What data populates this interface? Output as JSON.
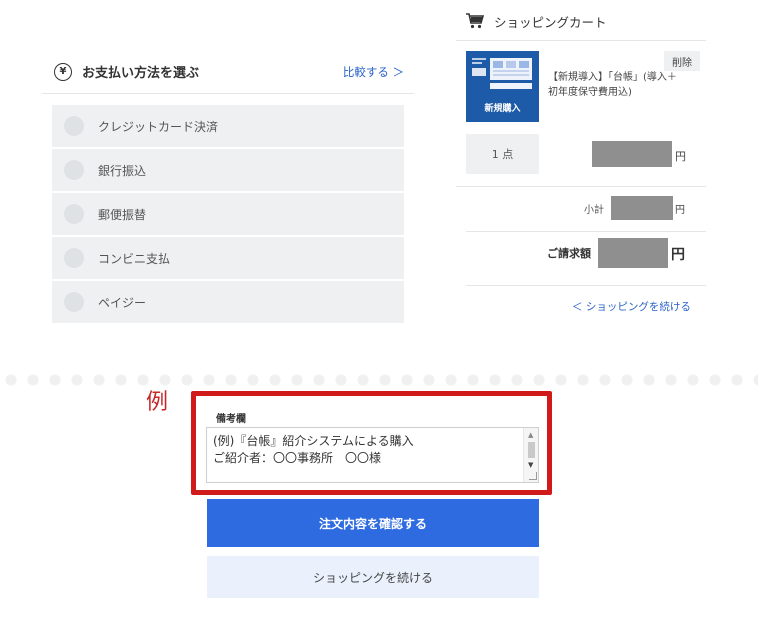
{
  "payment": {
    "title": "お支払い方法を選ぶ",
    "compare_link": "比較する ＞",
    "options": [
      {
        "label": "クレジットカード決済"
      },
      {
        "label": "銀行振込"
      },
      {
        "label": "郵便振替"
      },
      {
        "label": "コンビニ支払"
      },
      {
        "label": "ペイジー"
      }
    ]
  },
  "cart": {
    "title": "ショッピングカート",
    "delete_label": "削除",
    "product": {
      "thumb_label": "新規購入",
      "name": "【新規導入】「台帳」(導入＋初年度保守費用込)"
    },
    "quantity": "1 点",
    "price_unit": "円",
    "subtotal_label": "小計",
    "subtotal_unit": "円",
    "total_label": "ご請求額",
    "total_unit": "円",
    "continue_link": "＜ ショッピングを続ける"
  },
  "example_label": "例",
  "remarks": {
    "label": "備考欄",
    "value": "(例)『台帳』紹介システムによる購入\nご紹介者：〇〇事務所　〇〇様"
  },
  "buttons": {
    "confirm": "注文内容を確認する",
    "continue": "ショッピングを続ける"
  },
  "colors": {
    "accent_blue": "#2e6ae0",
    "highlight_red": "#d11a1a",
    "masked_gray": "#8f8f8f"
  }
}
